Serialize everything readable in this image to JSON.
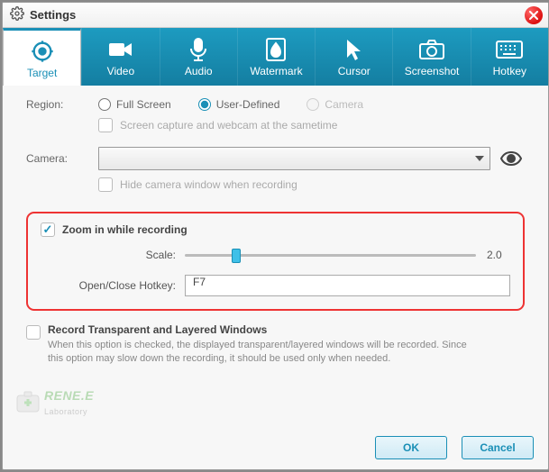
{
  "title": "Settings",
  "tabs": [
    {
      "label": "Target"
    },
    {
      "label": "Video"
    },
    {
      "label": "Audio"
    },
    {
      "label": "Watermark"
    },
    {
      "label": "Cursor"
    },
    {
      "label": "Screenshot"
    },
    {
      "label": "Hotkey"
    }
  ],
  "region": {
    "label": "Region:",
    "opts": {
      "full": "Full Screen",
      "user": "User-Defined",
      "camera": "Camera"
    },
    "sub": "Screen capture and webcam at the sametime"
  },
  "camera": {
    "label": "Camera:",
    "sub": "Hide camera window when recording"
  },
  "zoom": {
    "checkbox_label": "Zoom in while recording",
    "scale_label": "Scale:",
    "scale_value": "2.0",
    "hotkey_label": "Open/Close Hotkey:",
    "hotkey_value": "F7"
  },
  "recordlayer": {
    "head": "Record Transparent and Layered Windows",
    "desc": "When this option is checked, the displayed transparent/layered windows will be recorded. Since this option may slow down the recording, it should be used only when needed."
  },
  "brand": "RENE.E",
  "brand_sub": "Laboratory",
  "buttons": {
    "ok": "OK",
    "cancel": "Cancel"
  }
}
